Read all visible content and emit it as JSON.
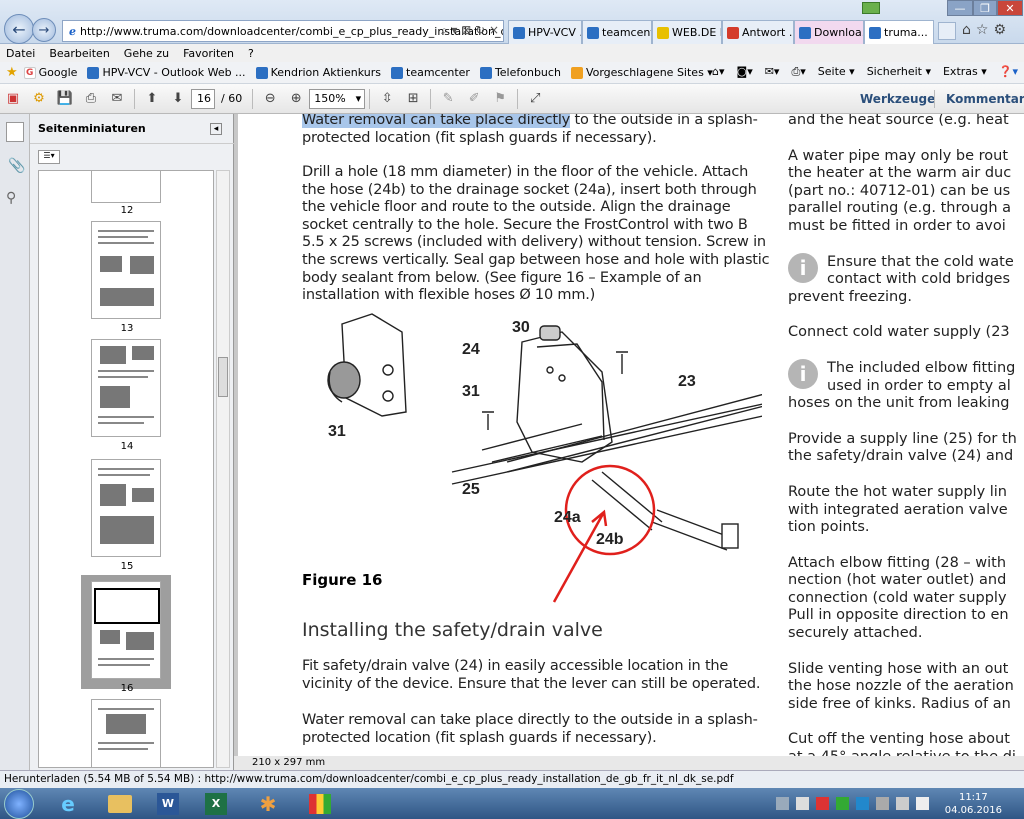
{
  "browser": {
    "url": "http://www.truma.com/downloadcenter/combi_e_cp_plus_ready_installation_de_gb_fr_i",
    "tabs": [
      {
        "label": "HPV-VCV ..."
      },
      {
        "label": "teamcent..."
      },
      {
        "label": "WEB.DE F..."
      },
      {
        "label": "Antwort ..."
      },
      {
        "label": "Downloa..."
      },
      {
        "label": "truma..."
      }
    ],
    "menu": [
      "Datei",
      "Bearbeiten",
      "Gehe zu",
      "Favoriten",
      "?"
    ],
    "favorites": [
      "Google",
      "HPV-VCV - Outlook Web ...",
      "Kendrion Aktienkurs",
      "teamcenter",
      "Telefonbuch",
      "Vorgeschlagene Sites ▾"
    ],
    "tools": [
      "Seite ▾",
      "Sicherheit ▾",
      "Extras ▾"
    ]
  },
  "pdf": {
    "page_current": "16",
    "page_total": "/ 60",
    "zoom": "150%",
    "tools_label": "Werkzeuge",
    "comment_label": "Kommentar",
    "sidebar_title": "Seitenminiaturen",
    "thumbnails": [
      "12",
      "13",
      "14",
      "15",
      "16"
    ],
    "page_size": "210 x 297 mm"
  },
  "doc": {
    "p1a": "Water removal can take place directly",
    "p1b": " to the outside in a splash-protected location (fit splash guards if necessary).",
    "p2": "Drill a hole (18 mm diameter) in the floor of the vehicle. Attach the hose (24b) to the drainage socket (24a), insert both through the vehicle floor and route to the outside. Align the drainage socket centrally to the hole. Secure the FrostControl with two B 5.5 x 25 screws (included with delivery) without tension. Screw in the screws vertically. Seal gap between hose and hole with plastic body sealant from below. (See figure 16 – Example of an installation with flexible hoses Ø 10 mm.)",
    "fig_labels": [
      "30",
      "24",
      "31",
      "23",
      "25",
      "31",
      "24a",
      "24b"
    ],
    "figure_caption": "Figure 16",
    "heading": "Installing the safety/drain valve",
    "p3": "Fit safety/drain valve (24) in easily accessible location in the vicinity of the device. Ensure that the lever can still be operated.",
    "p4": "Water removal can take place directly to the outside in a splash-protected location (fit splash guards if necessary).",
    "right_col": [
      "and the heat source (e.g. heat",
      "",
      "A water pipe may only be rout",
      "the heater at the warm air duc",
      "(part no.: 40712-01) can be us",
      "parallel routing (e.g. through a",
      "must be fitted in order to avoi",
      "",
      "Ensure that the cold wate",
      "contact with cold bridges",
      "prevent freezing.",
      "",
      "Connect cold water supply (23",
      "",
      "The included elbow fitting",
      "used in order to empty al",
      "hoses on the unit from leaking",
      "",
      "Provide a supply line (25) for th",
      "the safety/drain valve (24) and",
      "",
      "Route the hot water supply lin",
      "with integrated aeration valve",
      "tion points.",
      "",
      "Attach elbow fitting (28 – with",
      "nection (hot water outlet) and",
      "connection (cold water supply",
      "Pull in opposite direction to en",
      "securely attached.",
      "",
      "Slide venting hose with an out",
      "the hose nozzle of the aeration",
      "side free of kinks. Radius of an",
      "",
      "Cut off the venting hose about",
      "at a 45° angle relative to the di"
    ]
  },
  "status": "Herunterladen (5.54 MB of 5.54 MB) : http://www.truma.com/downloadcenter/combi_e_cp_plus_ready_installation_de_gb_fr_it_nl_dk_se.pdf",
  "clock": {
    "time": "11:17",
    "date": "04.06.2016"
  },
  "colors": {
    "accent": "#2b4f7b",
    "highlight": "#a8c6ea",
    "annotation": "#e0201c"
  }
}
